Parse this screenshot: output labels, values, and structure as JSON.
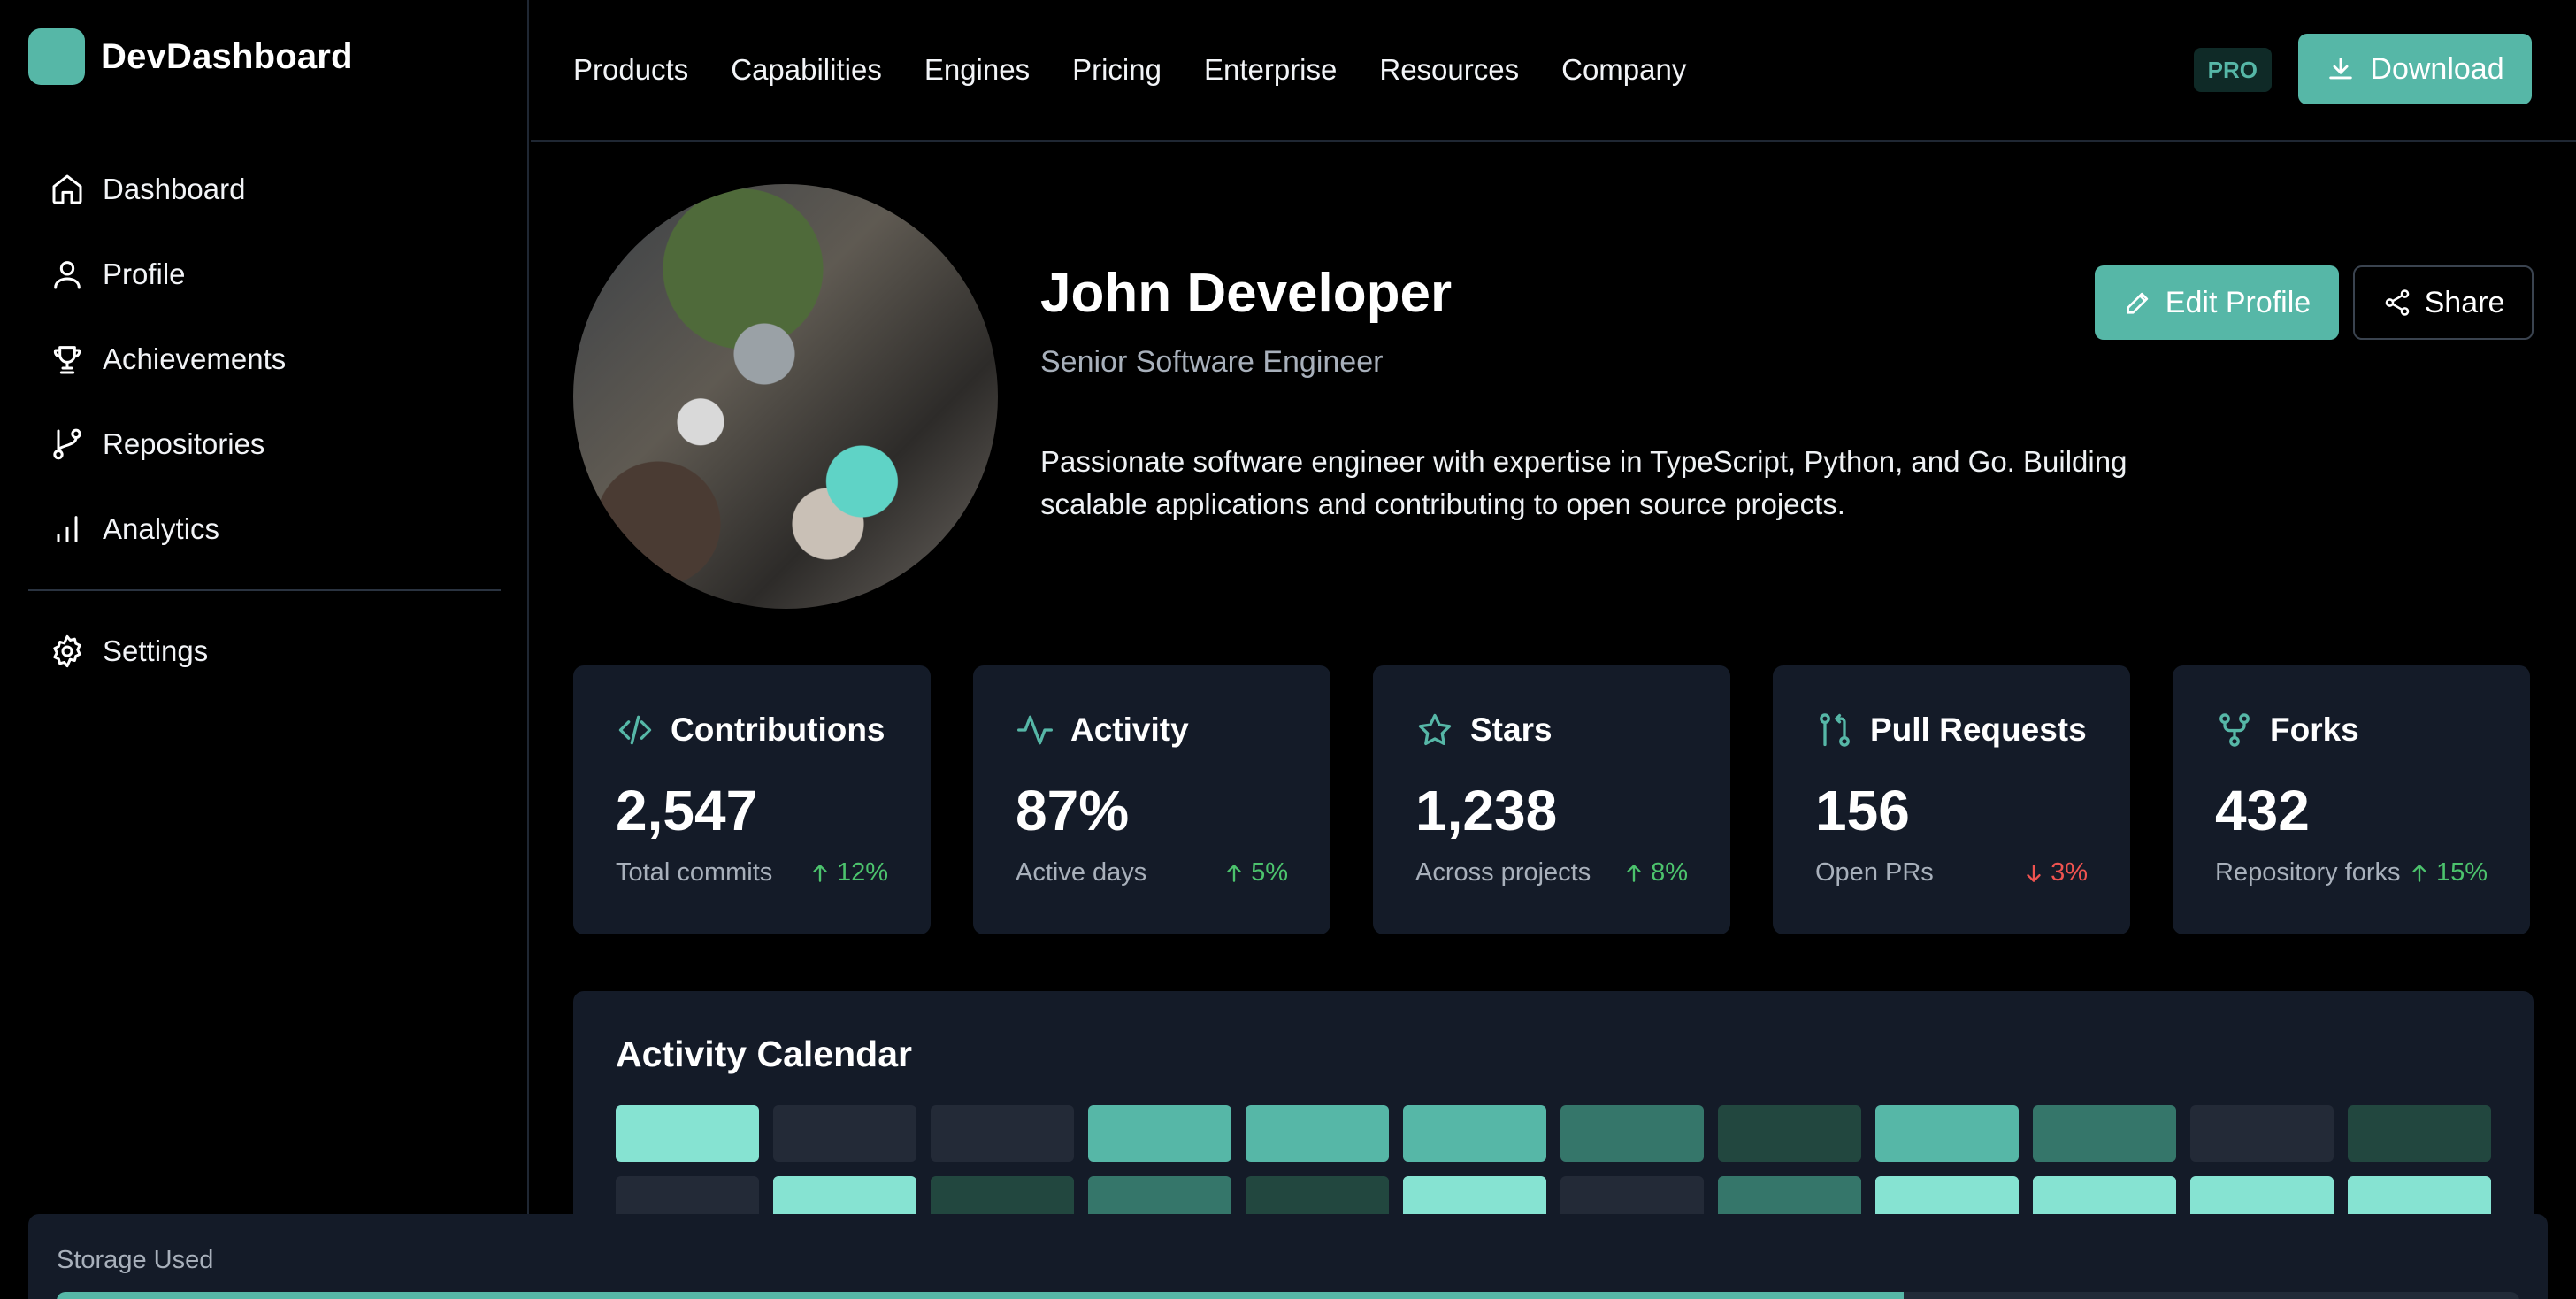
{
  "brand": {
    "name": "DevDashboard"
  },
  "sidebar": {
    "items": [
      {
        "label": "Dashboard",
        "icon": "home-icon"
      },
      {
        "label": "Profile",
        "icon": "user-icon"
      },
      {
        "label": "Achievements",
        "icon": "trophy-icon"
      },
      {
        "label": "Repositories",
        "icon": "git-branch-icon"
      },
      {
        "label": "Analytics",
        "icon": "bar-chart-icon"
      }
    ],
    "settings": {
      "label": "Settings",
      "icon": "gear-icon"
    }
  },
  "topnav": {
    "items": [
      "Products",
      "Capabilities",
      "Engines",
      "Pricing",
      "Enterprise",
      "Resources",
      "Company"
    ],
    "badge": "PRO",
    "download_label": "Download"
  },
  "profile": {
    "name": "John Developer",
    "title": "Senior Software Engineer",
    "bio": "Passionate software engineer with expertise in TypeScript, Python, and Go. Building scalable applications and contributing to open source projects.",
    "edit_label": "Edit Profile",
    "share_label": "Share"
  },
  "stats": [
    {
      "title": "Contributions",
      "value": "2,547",
      "sub": "Total commits",
      "trend": "12%",
      "direction": "up",
      "icon": "code-icon"
    },
    {
      "title": "Activity",
      "value": "87%",
      "sub": "Active days",
      "trend": "5%",
      "direction": "up",
      "icon": "activity-icon"
    },
    {
      "title": "Stars",
      "value": "1,238",
      "sub": "Across projects",
      "trend": "8%",
      "direction": "up",
      "icon": "star-icon"
    },
    {
      "title": "Pull Requests",
      "value": "156",
      "sub": "Open PRs",
      "trend": "3%",
      "direction": "down",
      "icon": "pull-request-icon"
    },
    {
      "title": "Forks",
      "value": "432",
      "sub": "Repository forks",
      "trend": "15%",
      "direction": "up",
      "icon": "fork-icon"
    }
  ],
  "calendar": {
    "title": "Activity Calendar",
    "levels": [
      [
        4,
        0,
        0,
        3,
        3,
        3,
        2,
        1,
        3,
        2,
        0,
        1
      ],
      [
        0,
        4,
        1,
        2,
        1,
        4,
        0,
        2,
        4,
        4,
        4,
        4
      ]
    ],
    "colors": [
      "#232a37",
      "#22473f",
      "#35766a",
      "#56b7a7",
      "#86e3d2"
    ]
  },
  "storage": {
    "label": "Storage Used",
    "used_fraction": 0.75
  },
  "colors": {
    "accent": "#56b7a7",
    "up": "#4cc36d",
    "down": "#ef5350",
    "card": "#141b28"
  }
}
